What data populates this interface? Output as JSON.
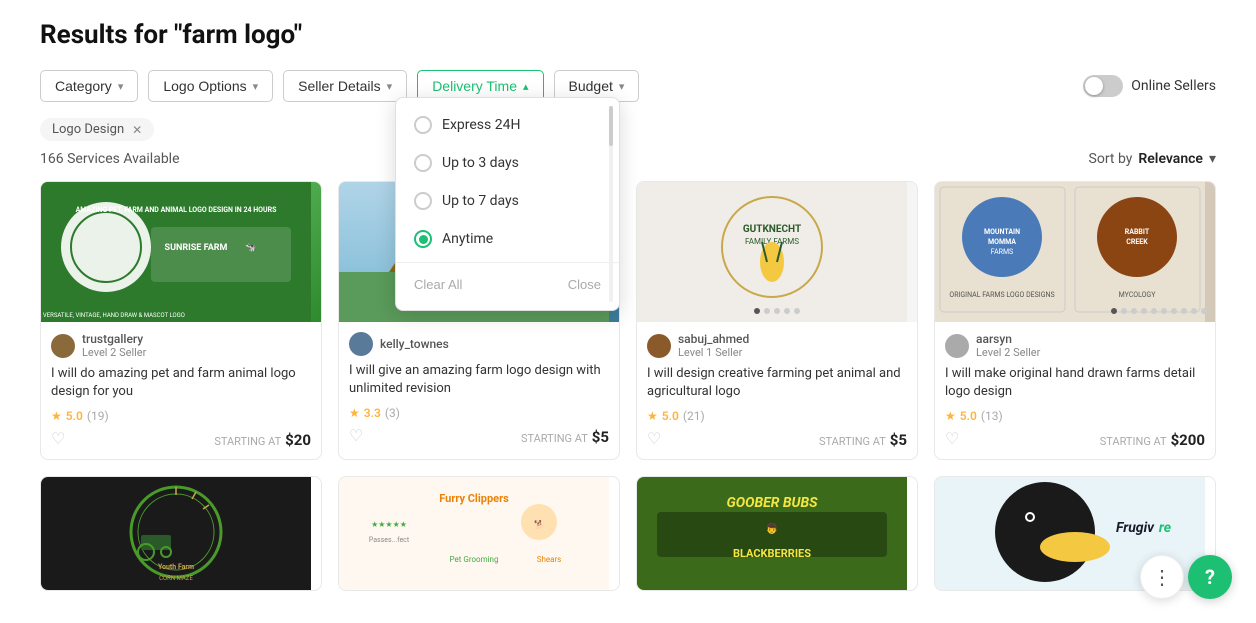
{
  "page": {
    "title": "Results for \"farm logo\""
  },
  "filters": {
    "category_label": "Category",
    "logo_options_label": "Logo Options",
    "seller_details_label": "Seller Details",
    "delivery_time_label": "Delivery Time",
    "budget_label": "Budget",
    "online_sellers_label": "Online Sellers"
  },
  "active_tag": "Logo Design",
  "results_count": "166 Services Available",
  "sort": {
    "prefix": "Sort by",
    "value": "Relevance"
  },
  "delivery_dropdown": {
    "options": [
      {
        "id": "express",
        "label": "Express 24H",
        "checked": false
      },
      {
        "id": "3days",
        "label": "Up to 3 days",
        "checked": false
      },
      {
        "id": "7days",
        "label": "Up to 7 days",
        "checked": false
      },
      {
        "id": "anytime",
        "label": "Anytime",
        "checked": true
      }
    ],
    "clear_label": "Clear All",
    "close_label": "Close"
  },
  "cards": [
    {
      "id": 1,
      "seller_name": "trustgallery",
      "seller_level": "Level 2 Seller",
      "title": "I will do amazing pet and farm animal logo design for you",
      "rating": "5.0",
      "rating_count": "(19)",
      "starting_at": "STARTING AT",
      "price": "$20",
      "img_type": "green"
    },
    {
      "id": 2,
      "seller_name": "kelly_townes",
      "seller_level": "",
      "title": "I will give an amazing farm logo design with unlimited revision",
      "rating": "3.3",
      "rating_count": "(3)",
      "starting_at": "STARTING AT",
      "price": "$5",
      "img_type": "river"
    },
    {
      "id": 3,
      "seller_name": "sabuj_ahmed",
      "seller_level": "Level 1 Seller",
      "title": "I will design creative farming pet animal and agricultural logo",
      "rating": "5.0",
      "rating_count": "(21)",
      "starting_at": "STARTING AT",
      "price": "$5",
      "img_type": "white"
    },
    {
      "id": 4,
      "seller_name": "aarsyn",
      "seller_level": "Level 2 Seller",
      "title": "I will make original hand drawn farms detail logo design",
      "rating": "5.0",
      "rating_count": "(13)",
      "starting_at": "STARTING AT",
      "price": "$200",
      "img_type": "dark"
    },
    {
      "id": 5,
      "seller_name": "",
      "seller_level": "",
      "title": "",
      "rating": "",
      "rating_count": "",
      "starting_at": "",
      "price": "",
      "img_type": "farm"
    },
    {
      "id": 6,
      "seller_name": "",
      "seller_level": "",
      "title": "",
      "rating": "",
      "rating_count": "",
      "starting_at": "",
      "price": "",
      "img_type": "tools"
    },
    {
      "id": 7,
      "seller_name": "",
      "seller_level": "",
      "title": "",
      "rating": "",
      "rating_count": "",
      "starting_at": "",
      "price": "",
      "img_type": "berry"
    },
    {
      "id": 8,
      "seller_name": "",
      "seller_level": "",
      "title": "",
      "rating": "",
      "rating_count": "",
      "starting_at": "",
      "price": "",
      "img_type": "bird"
    }
  ]
}
